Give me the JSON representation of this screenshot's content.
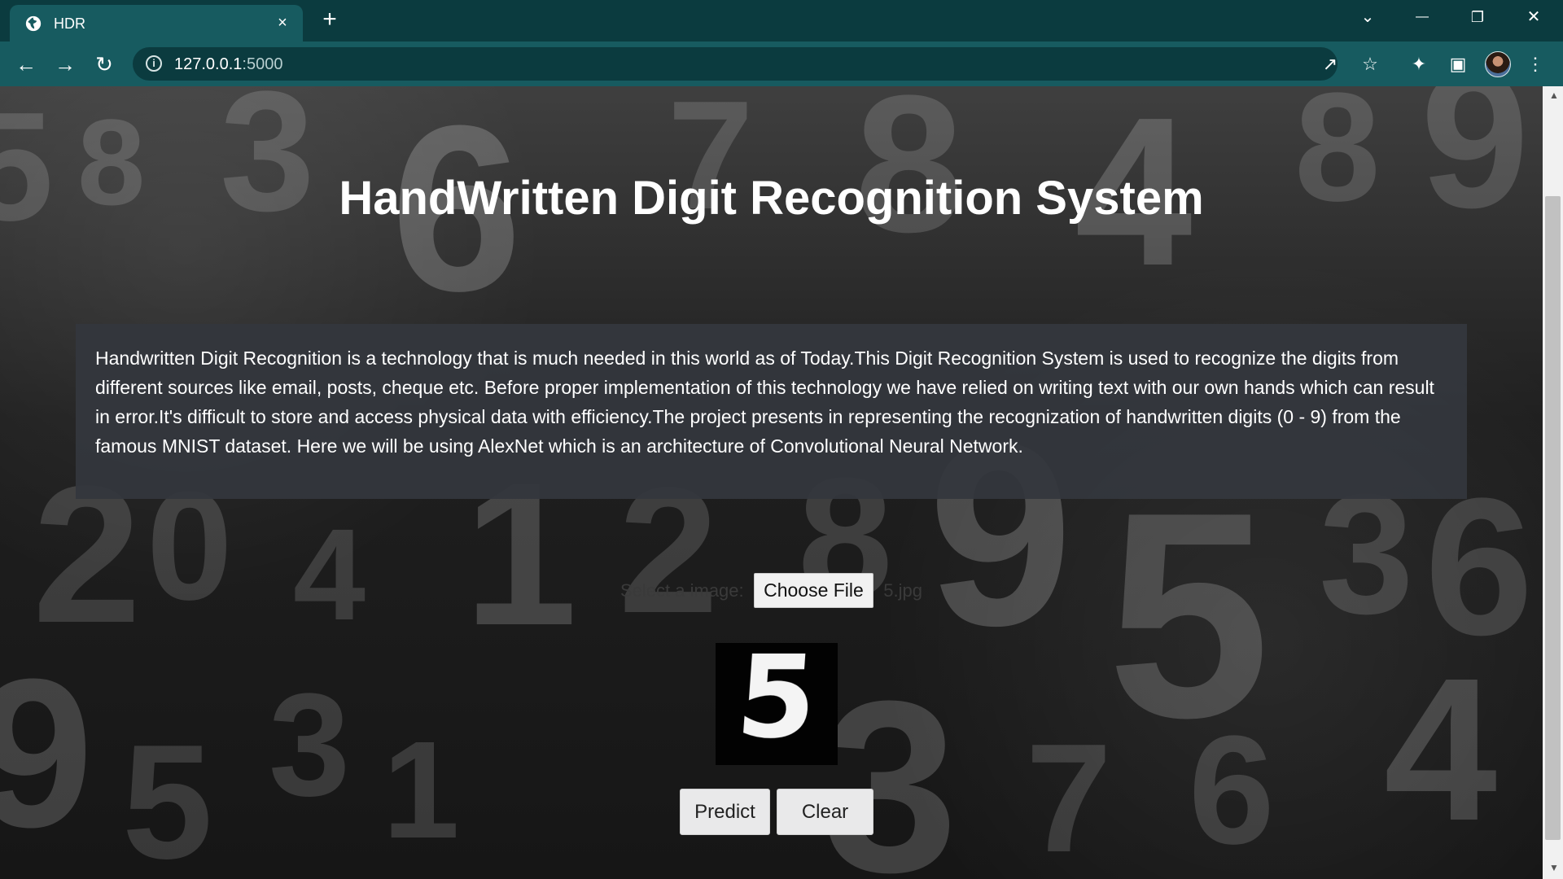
{
  "browser": {
    "tab": {
      "title": "HDR",
      "close": "×"
    },
    "new_tab": "+",
    "window_controls": {
      "dropdown": "⌄",
      "minimize": "—",
      "restore": "❐",
      "close": "✕"
    },
    "navigation": {
      "back": "←",
      "forward": "→",
      "reload": "↻"
    },
    "address": {
      "host": "127.0.0.1",
      "port": ":5000"
    },
    "toolbar_icons": {
      "share": "↗",
      "star": "☆",
      "extensions": "✦",
      "sidebar": "▣",
      "menu": "⋮"
    }
  },
  "page": {
    "title": "HandWritten Digit Recognition System",
    "description": "Handwritten Digit Recognition is a technology that is much needed in this world as of Today.This Digit Recognition System is used to recognize the digits from different sources like email, posts, cheque etc. Before proper implementation of this technology we have relied on writing text with our own hands which can result in error.It's difficult to store and access physical data with efficiency.The project presents in representing the recognization of handwritten digits (0 - 9) from the famous MNIST dataset. Here we will be using AlexNet which is an architecture of Convolutional Neural Network.",
    "upload": {
      "label": "Select a image:",
      "button": "Choose File",
      "file_name": "5.jpg"
    },
    "preview_digit": "5",
    "buttons": {
      "predict": "Predict",
      "clear": "Clear"
    }
  }
}
